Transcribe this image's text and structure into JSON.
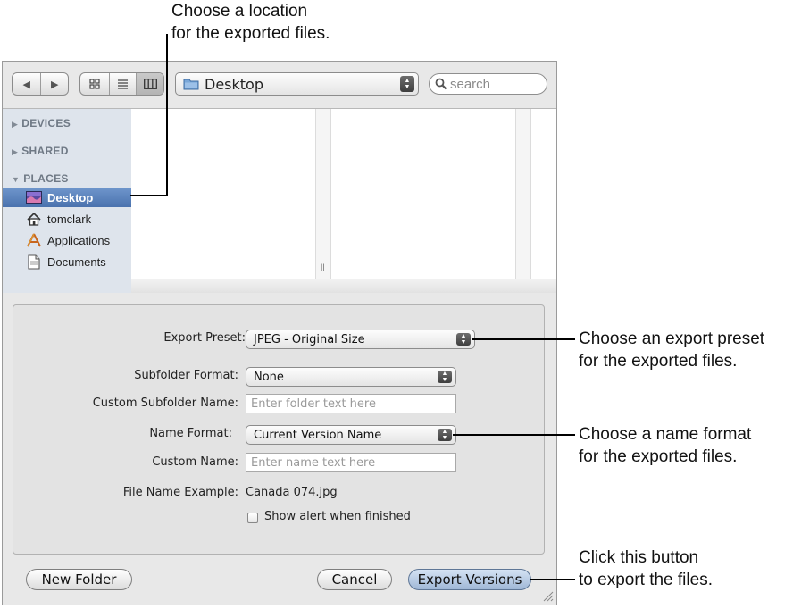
{
  "annotations": {
    "location": [
      "Choose a location",
      "for the exported files."
    ],
    "preset": [
      "Choose an export preset",
      "for the exported files."
    ],
    "name_format": [
      "Choose a name format",
      "for the exported files."
    ],
    "button": [
      "Click this button",
      "to export the files."
    ]
  },
  "toolbar": {
    "back_icon": "triangle-left",
    "forward_icon": "triangle-right",
    "location": "Desktop",
    "search_placeholder": "search"
  },
  "sidebar": {
    "sections": [
      {
        "label": "DEVICES",
        "expanded": false
      },
      {
        "label": "SHARED",
        "expanded": false
      },
      {
        "label": "PLACES",
        "expanded": true
      }
    ],
    "items": [
      {
        "label": "Desktop",
        "icon": "desktop-icon",
        "selected": true
      },
      {
        "label": "tomclark",
        "icon": "home-icon",
        "selected": false
      },
      {
        "label": "Applications",
        "icon": "applications-icon",
        "selected": false
      },
      {
        "label": "Documents",
        "icon": "documents-icon",
        "selected": false
      }
    ]
  },
  "form": {
    "export_preset": {
      "label": "Export Preset:",
      "value": "JPEG - Original Size"
    },
    "subfolder_format": {
      "label": "Subfolder Format:",
      "value": "None"
    },
    "custom_subfolder": {
      "label": "Custom Subfolder Name:",
      "placeholder": "Enter folder text here"
    },
    "name_format": {
      "label": "Name Format:",
      "value": "Current Version Name"
    },
    "custom_name": {
      "label": "Custom Name:",
      "placeholder": "Enter name text here"
    },
    "file_name_example": {
      "label": "File Name Example:",
      "value": "Canada 074.jpg"
    },
    "show_alert": {
      "label": "Show alert when finished",
      "checked": false
    }
  },
  "buttons": {
    "new_folder": "New Folder",
    "cancel": "Cancel",
    "export": "Export Versions"
  },
  "colors": {
    "selection": "#4a72ae",
    "sidebar_bg": "#dee4ec",
    "default_button": "#9fb7d6"
  }
}
